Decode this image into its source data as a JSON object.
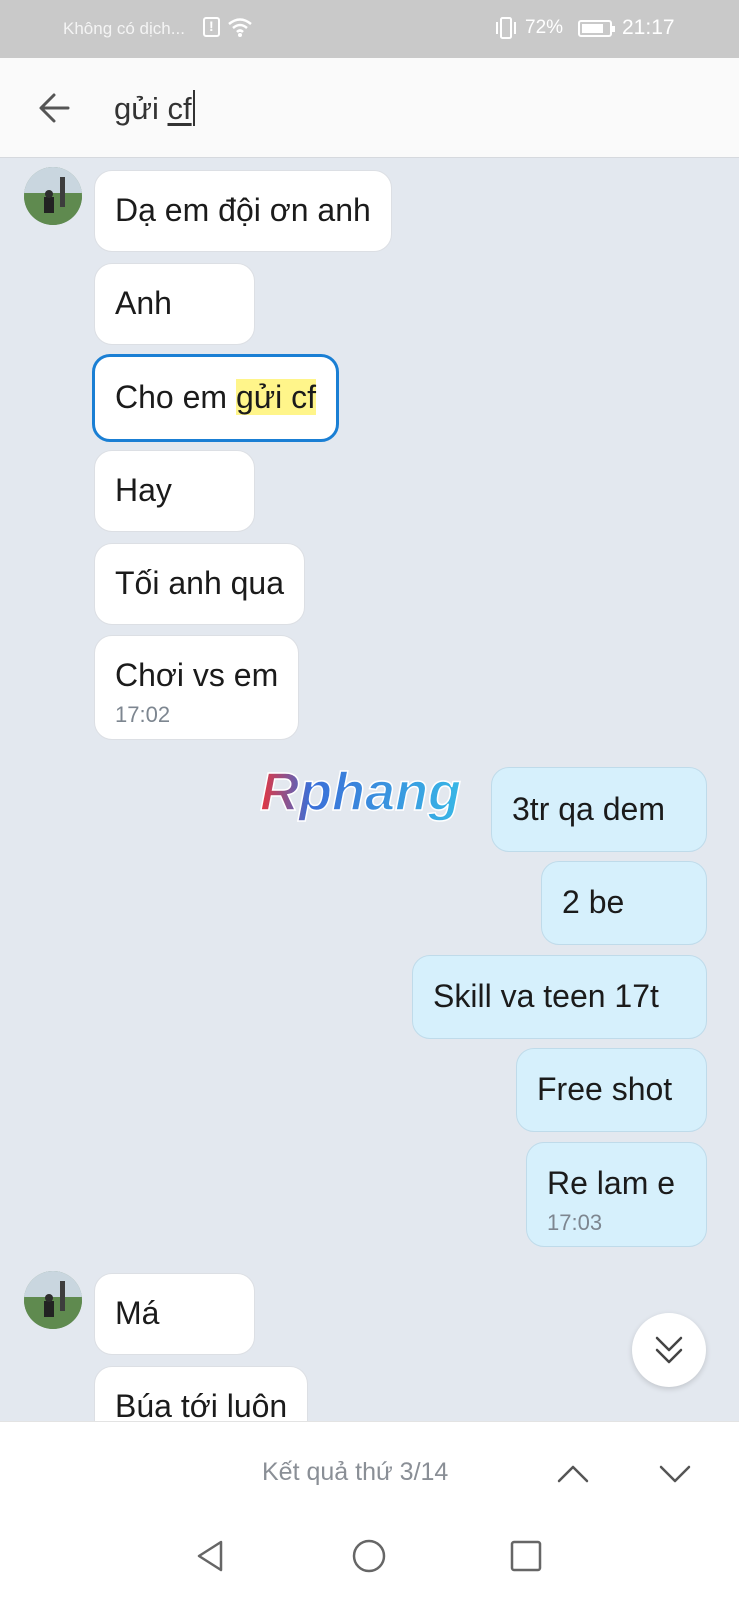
{
  "status_bar": {
    "carrier": "Không có dịch...",
    "battery_percent": "72%",
    "time": "21:17",
    "icons": [
      "alert-icon",
      "wifi-icon",
      "vibrate-icon",
      "battery-icon"
    ]
  },
  "search": {
    "query_plain": "gửi ",
    "query_underlined": "cf",
    "back_icon": "arrow-left-icon"
  },
  "messages": [
    {
      "dir": "in",
      "text": "Dạ em đội ơn anh"
    },
    {
      "dir": "in",
      "text": "Anh"
    },
    {
      "dir": "in",
      "text_before": "Cho em ",
      "text_highlight": "gửi cf",
      "highlighted": true
    },
    {
      "dir": "in",
      "text": "Hay"
    },
    {
      "dir": "in",
      "text": "Tối anh qua"
    },
    {
      "dir": "in",
      "text": "Chơi vs em",
      "time": "17:02"
    },
    {
      "dir": "out",
      "text": "3tr qa dem"
    },
    {
      "dir": "out",
      "text": "2 be"
    },
    {
      "dir": "out",
      "text": "Skill va teen 17t"
    },
    {
      "dir": "out",
      "text": "Free shot"
    },
    {
      "dir": "out",
      "text": "Re lam e",
      "time": "17:03"
    },
    {
      "dir": "in",
      "text": "Má"
    },
    {
      "dir": "in",
      "text": "Búa tới luôn"
    }
  ],
  "watermark": "Rphang",
  "result_bar": {
    "label": "Kết quả thứ 3/14",
    "up_icon": "chevron-up-icon",
    "down_icon": "chevron-down-icon"
  },
  "scroll_button_icon": "double-chevron-down-icon",
  "system_nav": [
    "nav-back-icon",
    "nav-home-icon",
    "nav-recent-icon"
  ],
  "colors": {
    "chat_background": "#e3e8ef",
    "incoming_bubble": "#ffffff",
    "outgoing_bubble": "#d6f0fc",
    "highlight_border": "#1a7fd4",
    "search_highlight": "#fff58a"
  }
}
